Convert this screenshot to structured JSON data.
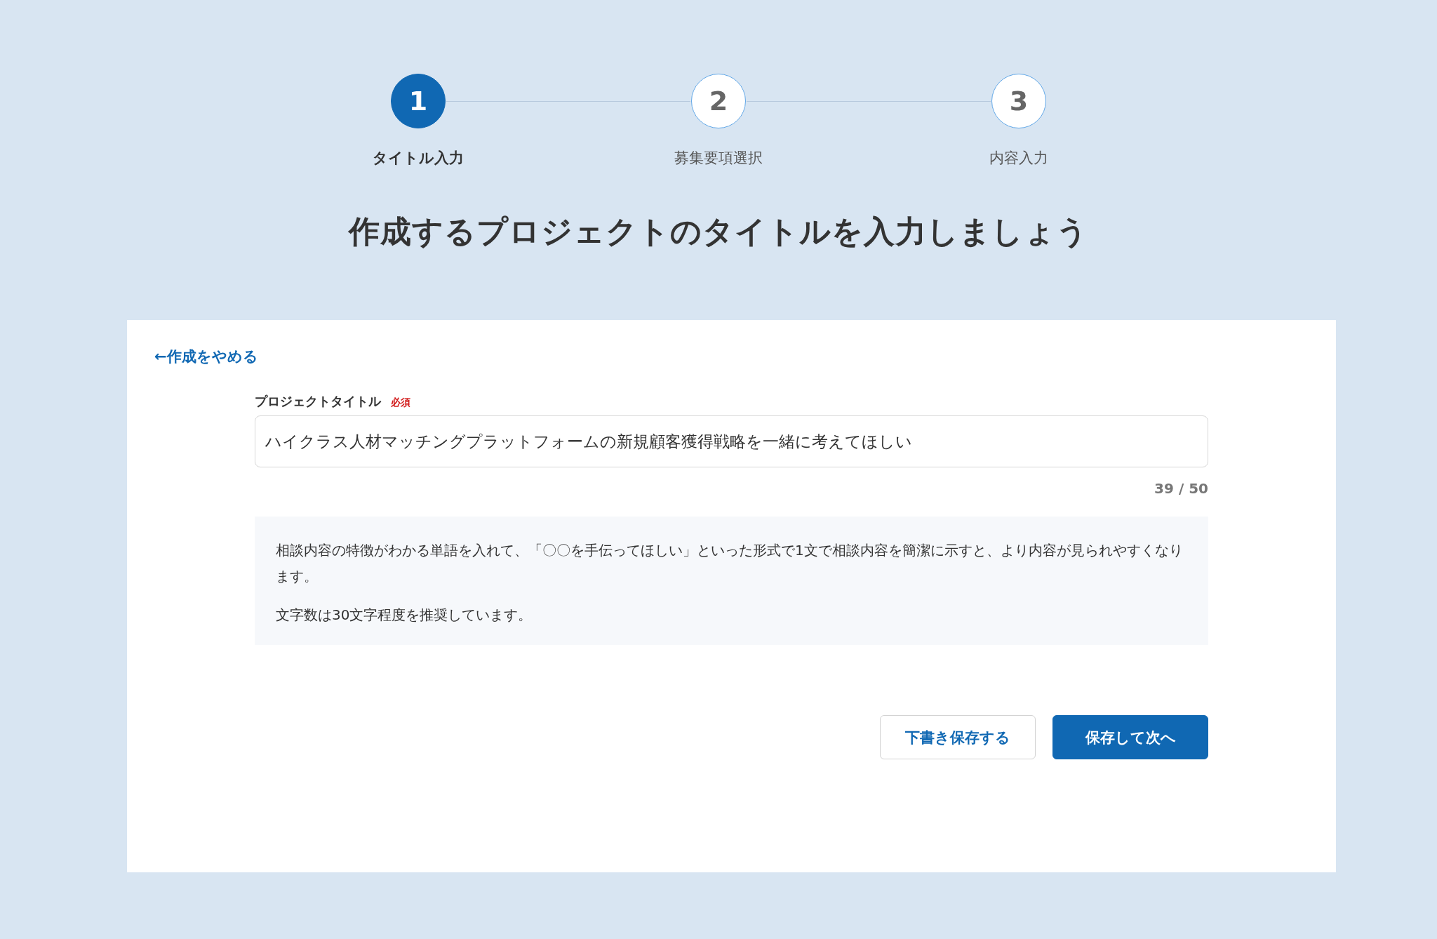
{
  "steps": [
    {
      "number": "1",
      "label": "タイトル入力",
      "selected": true
    },
    {
      "number": "2",
      "label": "募集要項選択",
      "selected": false
    },
    {
      "number": "3",
      "label": "内容入力",
      "selected": false
    }
  ],
  "heading": "作成するプロジェクトのタイトルを入力しましょう",
  "form": {
    "cancel_link": "←作成をやめる",
    "field_label": "プロジェクトタイトル",
    "required_badge": "必須",
    "title_value": "ハイクラス人材マッチングプラットフォームの新規顧客獲得戦略を一緒に考えてほしい",
    "char_count": "39 / 50",
    "hints": [
      "相談内容の特徴がわかる単語を入れて、「〇〇を手伝ってほしい」といった形式で1文で相談内容を簡潔に示すと、より内容が見られやすくなります。",
      "文字数は30文字程度を推奨しています。"
    ],
    "buttons": [
      {
        "label": "下書き保存する",
        "kind": "secondary"
      },
      {
        "label": "保存して次へ",
        "kind": "primary"
      }
    ]
  }
}
